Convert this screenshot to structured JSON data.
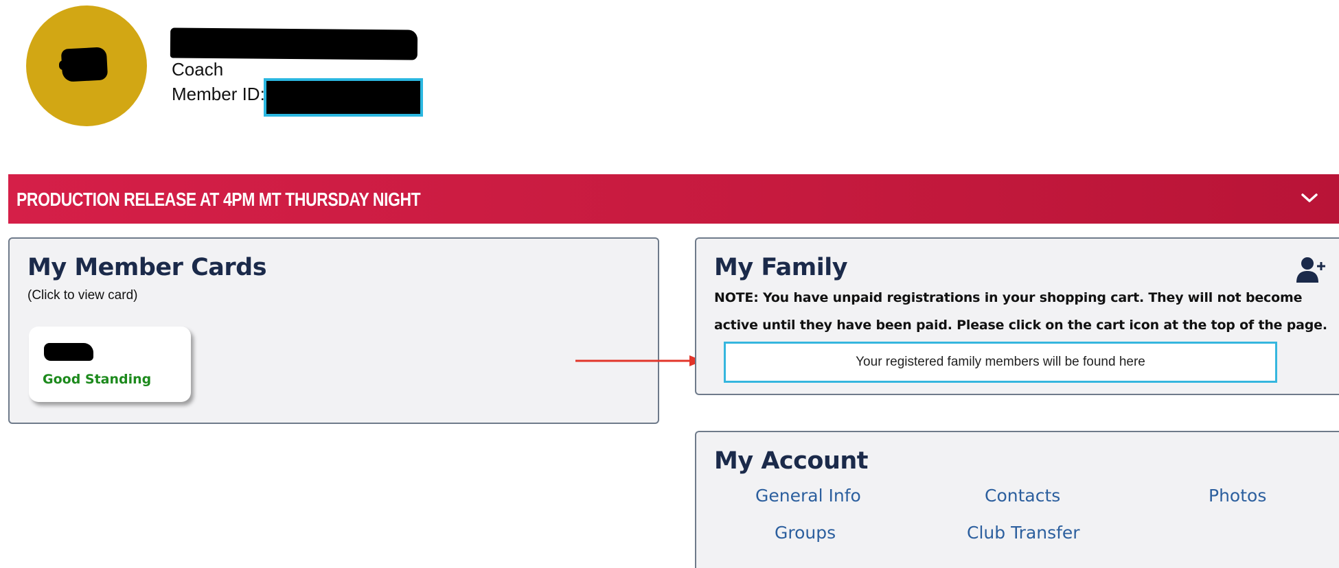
{
  "profile": {
    "role": "Coach",
    "member_id_label": "Member ID:"
  },
  "banner": {
    "text": "PRODUCTION RELEASE AT 4PM MT THURSDAY NIGHT",
    "icon": "chevron-down-icon"
  },
  "member_cards": {
    "title": "My Member Cards",
    "subtitle": "(Click to view card)",
    "cards": [
      {
        "status": "Good Standing"
      }
    ]
  },
  "family": {
    "title": "My Family",
    "add_icon": "add-user-icon",
    "note": "NOTE: You have unpaid registrations in your shopping cart. They will not become active until they have been paid. Please click on the cart icon at the top of the page.",
    "empty_message": "Your registered family members will be found here"
  },
  "account": {
    "title": "My Account",
    "links": [
      "General Info",
      "Contacts",
      "Photos",
      "Groups",
      "Club Transfer"
    ]
  },
  "colors": {
    "avatar": "#d2a714",
    "banner": "#c51a3e",
    "title": "#1b2a4a",
    "good_standing": "#1d8a1d",
    "link": "#2c5f9e",
    "highlight_border": "#35b6de",
    "arrow": "#e2352a"
  }
}
